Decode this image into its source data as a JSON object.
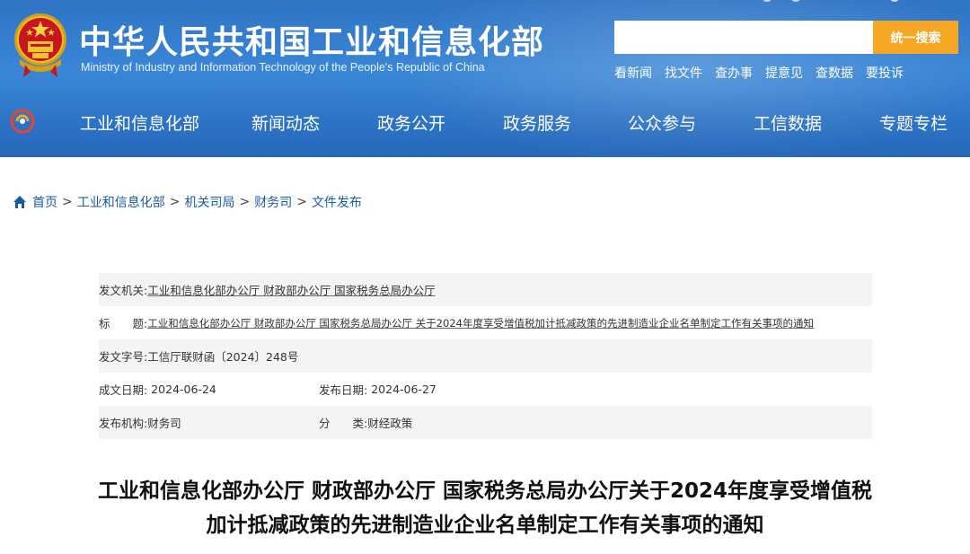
{
  "header": {
    "title": "中华人民共和国工业和信息化部",
    "subtitle": "Ministry of Industry and Information Technology of the People's Republic of China",
    "search": {
      "placeholder": "",
      "button_label": "统一搜索"
    },
    "quick_links": [
      "看新闻",
      "找文件",
      "查办事",
      "提意见",
      "查数据",
      "要投诉"
    ]
  },
  "nav": {
    "items": [
      "工业和信息化部",
      "新闻动态",
      "政务公开",
      "政务服务",
      "公众参与",
      "工信数据",
      "专题专栏"
    ]
  },
  "breadcrumb": {
    "items": [
      "首页",
      "工业和信息化部",
      "机关司局",
      "财务司",
      "文件发布"
    ],
    "separator": ">"
  },
  "doc_info": {
    "issuer_label": "发文机关:",
    "issuer_value": "工业和信息化部办公厅 财政部办公厅 国家税务总局办公厅",
    "title_label": "标　　题:",
    "title_value": "工业和信息化部办公厅 财政部办公厅 国家税务总局办公厅 关于2024年度享受增值税加计抵减政策的先进制造业企业名单制定工作有关事项的通知",
    "doc_no_label": "发文字号:",
    "doc_no_value": "工信厅联财函〔2024〕248号",
    "date_label": "成文日期:",
    "date_value": "2024-06-24",
    "publish_label": "发布日期:",
    "publish_value": "2024-06-27",
    "org_label": "发布机构:",
    "org_value": "财务司",
    "category_label": "分　　类:",
    "category_value": "财经政策"
  },
  "document": {
    "title_line1": "工业和信息化部办公厅 财政部办公厅 国家税务总局办公厅关于2024年度享受增值税",
    "title_line2": "加计抵减政策的先进制造业企业名单制定工作有关事项的通知"
  },
  "colors": {
    "header_blue": "#2f74c5",
    "search_button": "#f5a623",
    "link_blue": "#1a5ba6"
  }
}
